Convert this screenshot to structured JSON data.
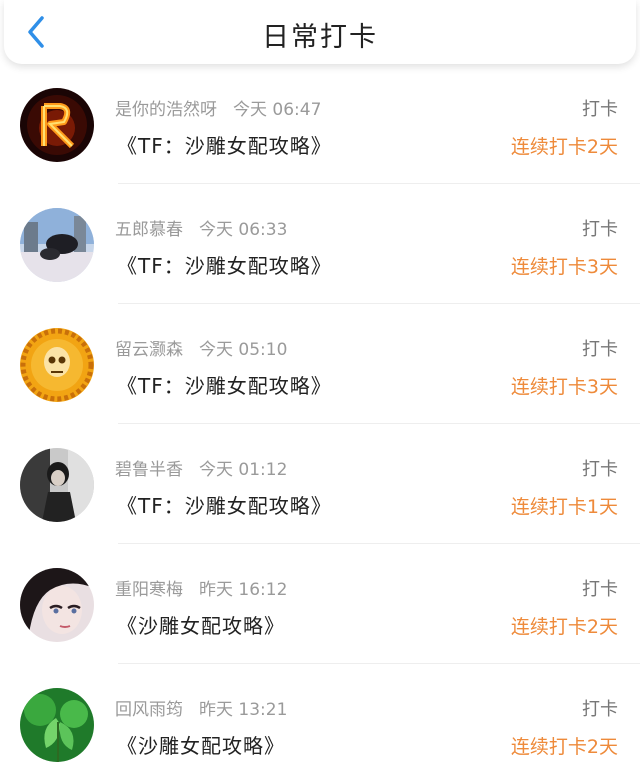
{
  "header": {
    "title": "日常打卡",
    "back_icon": "chevron-left-icon",
    "accent": "#2f8fe8"
  },
  "colors": {
    "streak": "#ee8a3a",
    "meta": "#9a9a9a"
  },
  "entries": [
    {
      "user": "是你的浩然呀",
      "time": "今天 06:47",
      "book": "《TF：沙雕女配攻略》",
      "action": "打卡",
      "streak": "连续打卡2天"
    },
    {
      "user": "五郎慕春",
      "time": "今天 06:33",
      "book": "《TF：沙雕女配攻略》",
      "action": "打卡",
      "streak": "连续打卡3天"
    },
    {
      "user": "留云灏森",
      "time": "今天 05:10",
      "book": "《TF：沙雕女配攻略》",
      "action": "打卡",
      "streak": "连续打卡3天"
    },
    {
      "user": "碧鲁半香",
      "time": "今天 01:12",
      "book": "《TF：沙雕女配攻略》",
      "action": "打卡",
      "streak": "连续打卡1天"
    },
    {
      "user": "重阳寒梅",
      "time": "昨天 16:12",
      "book": "《沙雕女配攻略》",
      "action": "打卡",
      "streak": "连续打卡2天"
    },
    {
      "user": "回风雨筠",
      "time": "昨天 13:21",
      "book": "《沙雕女配攻略》",
      "action": "打卡",
      "streak": "连续打卡2天"
    }
  ]
}
